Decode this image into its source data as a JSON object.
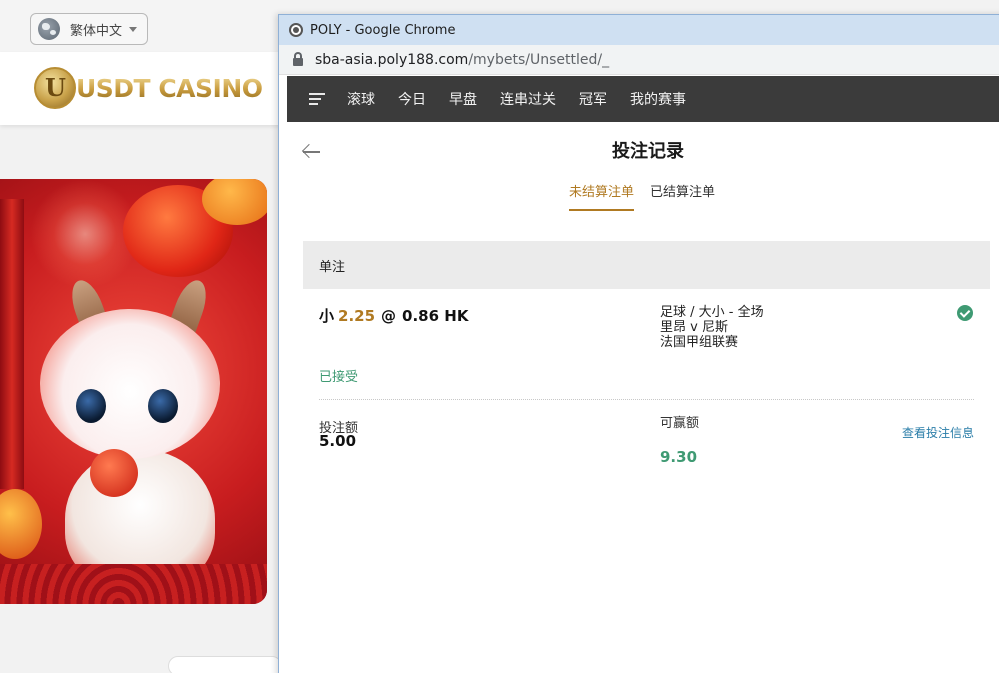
{
  "background_site": {
    "language_label": "繁体中文",
    "logo_text": "USDT CASINO",
    "logo_mark": "U"
  },
  "browser": {
    "window_title": "POLY - Google Chrome",
    "url_host": "sba-asia.poly188.com",
    "url_path": "/mybets/Unsettled/_"
  },
  "nav": {
    "items": [
      {
        "label": "滚球"
      },
      {
        "label": "今日"
      },
      {
        "label": "早盘"
      },
      {
        "label": "连串过关"
      },
      {
        "label": "冠军"
      },
      {
        "label": "我的赛事"
      }
    ]
  },
  "page": {
    "title": "投注记录",
    "tabs": [
      {
        "label": "未结算注单",
        "active": true
      },
      {
        "label": "已结算注单",
        "active": false
      }
    ],
    "section_title": "单注"
  },
  "bet": {
    "selection": "小",
    "handicap": "2.25",
    "at": "@",
    "odds": "0.86 HK",
    "market": "足球 / 大小 - 全场",
    "match": "里昂 v 尼斯",
    "league": "法国甲组联赛",
    "status": "已接受",
    "stake_label": "投注额",
    "stake_value": "5.00",
    "to_win_label": "可赢额",
    "to_win_value": "9.30",
    "details_link": "查看投注信息"
  },
  "colors": {
    "accent_gold": "#b07a22",
    "success_green": "#3f9a73",
    "link_blue": "#2a7da8",
    "navbar_bg": "#3b3b3b"
  }
}
